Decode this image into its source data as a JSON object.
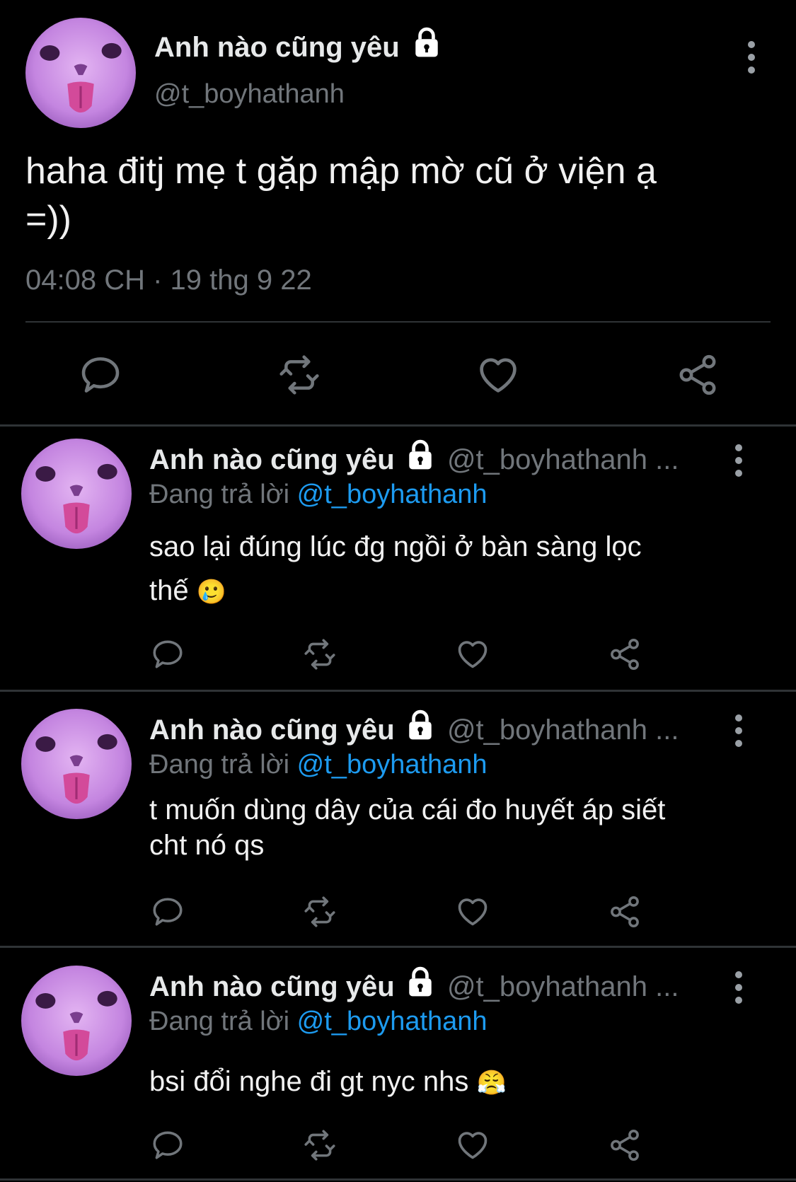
{
  "main_tweet": {
    "display_name": "Anh nào cũng yêu",
    "handle": "@t_boyhathanh",
    "text_line1": "haha đitj mẹ t gặp mập mờ cũ ở viện ạ",
    "text_line2": "=))",
    "timestamp": "04:08 CH · 19 thg 9 22"
  },
  "replies": [
    {
      "display_name": "Anh nào cũng yêu",
      "handle": "@t_boyhathanh ...",
      "replying_label": "Đang trả lời",
      "replying_to": "@t_boyhathanh",
      "text_line1": "sao lại đúng lúc đg ngồi ở bàn sàng lọc",
      "text_line2": "thế",
      "emoji": "🥲"
    },
    {
      "display_name": "Anh nào cũng yêu",
      "handle": "@t_boyhathanh ...",
      "replying_label": "Đang trả lời",
      "replying_to": "@t_boyhathanh",
      "text_line1": "t muốn dùng dây của cái đo huyết áp siết",
      "text_line2": "cht nó qs"
    },
    {
      "display_name": "Anh nào cũng yêu",
      "handle": "@t_boyhathanh ...",
      "replying_label": "Đang trả lời",
      "replying_to": "@t_boyhathanh",
      "text_line1": "bsi đổi nghe đi gt nyc nhs",
      "emoji": "😤"
    }
  ],
  "icons": [
    "lock-icon",
    "more-icon",
    "reply-icon",
    "retweet-icon",
    "like-icon",
    "share-icon"
  ],
  "colors": {
    "background": "#000000",
    "text": "#e7e9ea",
    "muted": "#71767b",
    "link": "#1d9bf0",
    "divider": "#2f3336"
  }
}
